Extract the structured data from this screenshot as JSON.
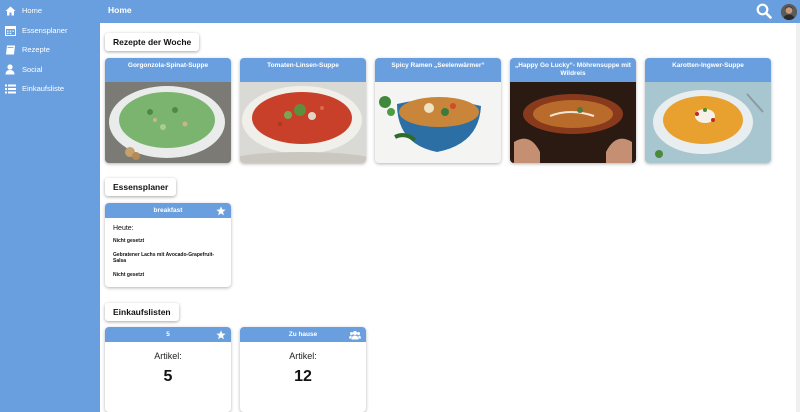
{
  "sidebar": {
    "items": [
      {
        "label": "Home",
        "icon": "home-icon"
      },
      {
        "label": "Essensplaner",
        "icon": "calendar-icon"
      },
      {
        "label": "Rezepte",
        "icon": "book-icon"
      },
      {
        "label": "Social",
        "icon": "user-icon"
      },
      {
        "label": "Einkaufsliste",
        "icon": "list-icon"
      }
    ]
  },
  "header": {
    "title": "Home",
    "search_icon": "search-icon",
    "avatar_icon": "avatar"
  },
  "recipes": {
    "title": "Rezepte der Woche",
    "items": [
      {
        "name": "Gorgonzola-Spinat-Suppe",
        "soup_color": "#6fa86b"
      },
      {
        "name": "Tomaten-Linsen-Suppe",
        "soup_color": "#c8402a"
      },
      {
        "name": "Spicy Ramen „Seelenwärmer“",
        "soup_color": "#c9863a"
      },
      {
        "name": "„Happy Go Lucky“- Möhrensuppe mit Wildreis",
        "soup_color": "#b86b2a"
      },
      {
        "name": "Karotten-Ingwer-Suppe",
        "soup_color": "#e8a12e"
      }
    ]
  },
  "planner": {
    "title": "Essensplaner",
    "card": {
      "meal": "breakfast",
      "icon": "star-icon",
      "today_label": "Heute:",
      "entries": [
        "Nicht gesetzt",
        "Gebratener Lachs mit Avocado-Grapefruit-Salsa",
        "Nicht gesetzt"
      ]
    }
  },
  "lists": {
    "title": "Einkaufslisten",
    "items": [
      {
        "name": "5",
        "icon": "star-icon",
        "label": "Artikel:",
        "count": "5"
      },
      {
        "name": "Zu hause",
        "icon": "group-icon",
        "label": "Artikel:",
        "count": "12"
      }
    ]
  },
  "colors": {
    "accent": "#6a9fdf",
    "background": "#ffffff"
  }
}
